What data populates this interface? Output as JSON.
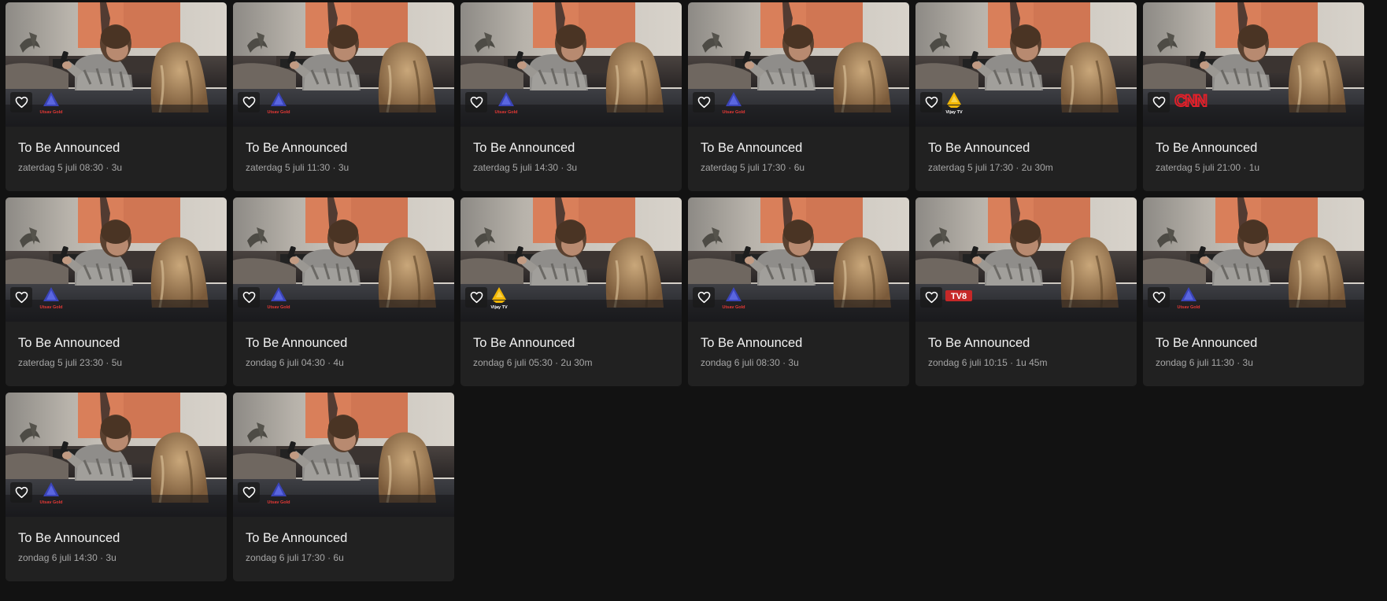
{
  "page": {
    "background": "#121212",
    "card_background": "#212121"
  },
  "channels": {
    "utsav-gold": {
      "icon": "utsav-gold-logo",
      "caption": "Utsav Gold"
    },
    "vijay-tv": {
      "icon": "vijay-tv-logo",
      "caption": "Vijay TV"
    },
    "cnn": {
      "icon": "cnn-logo",
      "caption": "CNN"
    },
    "tv8": {
      "icon": "tv8-logo",
      "caption": "TV8"
    }
  },
  "cards": [
    {
      "title": "To Be Announced",
      "meta": "zaterdag 5 juli 08:30 · 3u",
      "channel": "utsav-gold"
    },
    {
      "title": "To Be Announced",
      "meta": "zaterdag 5 juli 11:30 · 3u",
      "channel": "utsav-gold"
    },
    {
      "title": "To Be Announced",
      "meta": "zaterdag 5 juli 14:30 · 3u",
      "channel": "utsav-gold"
    },
    {
      "title": "To Be Announced",
      "meta": "zaterdag 5 juli 17:30 · 6u",
      "channel": "utsav-gold"
    },
    {
      "title": "To Be Announced",
      "meta": "zaterdag 5 juli 17:30 · 2u 30m",
      "channel": "vijay-tv"
    },
    {
      "title": "To Be Announced",
      "meta": "zaterdag 5 juli 21:00 · 1u",
      "channel": "cnn"
    },
    {
      "title": "To Be Announced",
      "meta": "zaterdag 5 juli 23:30 · 5u",
      "channel": "utsav-gold"
    },
    {
      "title": "To Be Announced",
      "meta": "zondag 6 juli 04:30 · 4u",
      "channel": "utsav-gold"
    },
    {
      "title": "To Be Announced",
      "meta": "zondag 6 juli 05:30 · 2u 30m",
      "channel": "vijay-tv"
    },
    {
      "title": "To Be Announced",
      "meta": "zondag 6 juli 08:30 · 3u",
      "channel": "utsav-gold"
    },
    {
      "title": "To Be Announced",
      "meta": "zondag 6 juli 10:15 · 1u 45m",
      "channel": "tv8"
    },
    {
      "title": "To Be Announced",
      "meta": "zondag 6 juli 11:30 · 3u",
      "channel": "utsav-gold"
    },
    {
      "title": "To Be Announced",
      "meta": "zondag 6 juli 14:30 · 3u",
      "channel": "utsav-gold"
    },
    {
      "title": "To Be Announced",
      "meta": "zondag 6 juli 17:30 · 6u",
      "channel": "utsav-gold"
    }
  ],
  "icons": {
    "favorite": "heart-outline-icon"
  }
}
